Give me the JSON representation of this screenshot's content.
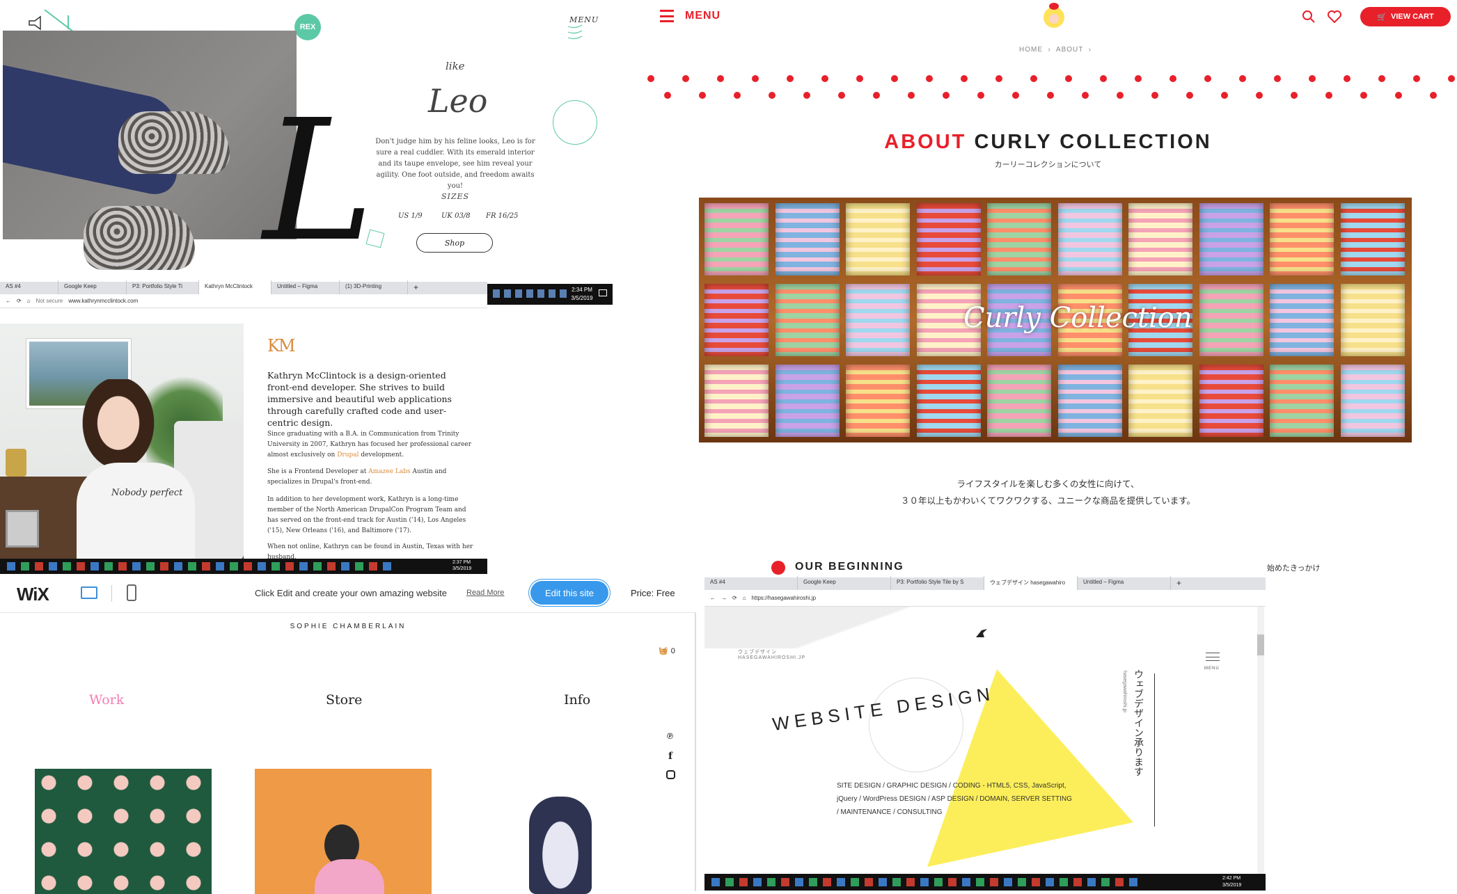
{
  "shoe_site": {
    "menu": "MENU",
    "like": "like",
    "name": "Leo",
    "big_letter": "L",
    "description": "Don't judge him by his feline looks, Leo is for sure a real cuddler. With its emerald interior and its taupe envelope, see him reveal your agility. One foot outside, and freedom awaits you!",
    "sizes_label": "SIZES",
    "sizes": [
      "US 1/9",
      "UK 03/8",
      "FR 16/25"
    ],
    "shop_button": "Shop",
    "logo_text": "REX"
  },
  "browser1": {
    "tabs": [
      "AS #4",
      "Google Keep",
      "P3: Portfolio Style Ti",
      "Kathryn McClintock",
      "Untitled – Figma",
      "(1) 3D-Printing"
    ],
    "url_prefix": "Not secure",
    "url": "www.kathrynmcclintock.com",
    "time": "2:34 PM",
    "date": "3/5/2019"
  },
  "km_site": {
    "logo": "KM",
    "intro": "Kathryn McClintock is a design-oriented front-end developer. She strives to build immersive and beautiful web applications through carefully crafted code and user-centric design.",
    "p1_a": "Since graduating with a B.A. in Communication from Trinity University in 2007, Kathryn has focused her professional career almost exclusively on ",
    "p1_link": "Drupal",
    "p1_b": " development.",
    "p2_a": "She is a Frontend Developer at ",
    "p2_link": "Amazee Labs",
    "p2_b": " Austin and specializes in Drupal's front-end.",
    "p3": "In addition to her development work, Kathryn is a long-time member of the North American DrupalCon Program Team and has served on the front-end track for Austin ('14), Los Angeles ('15), New Orleans ('16), and Baltimore ('17).",
    "p4": "When not online, Kathryn can be found in Austin, Texas with her husband, ",
    "shirt_text": "Nobody perfect",
    "time": "2:37 PM",
    "date": "3/5/2019"
  },
  "curly_site": {
    "menu": "MENU",
    "view_cart": "VIEW CART",
    "breadcrumb": [
      "HOME",
      "ABOUT"
    ],
    "title_a": "ABOUT",
    "title_b": "CURLY COLLECTION",
    "subtitle_jp": "カーリーコレクションについて",
    "hero_text": "Curly Collection",
    "desc_line1": "ライフスタイルを楽しむ多くの女性に向けて、",
    "desc_line2": "３０年以上もかわいくてワクワクする、ユニークな商品を提供しています。",
    "section_title": "OUR BEGINNING",
    "section_jp": "始めたきっかけ"
  },
  "wix_site": {
    "logo": "WiX",
    "cta_text": "Click Edit and create your own amazing website",
    "read_more": "Read More",
    "edit_button": "Edit this site",
    "price": "Price: Free",
    "site_name": "SOPHIE CHAMBERLAIN",
    "cart_count": "0",
    "nav": [
      "Work",
      "Store",
      "Info"
    ],
    "accent": "#f27eb3"
  },
  "browser2": {
    "tabs": [
      "AS #4",
      "Google Keep",
      "P3: Portfolio Style Tile by S",
      "ウェブデザイン hasegawahiro",
      "Untitled – Figma"
    ],
    "url": "https://hasegawahiroshi.jp",
    "time": "2:42 PM",
    "date": "3/5/2019"
  },
  "hasegawa_site": {
    "logo_jp": "ウェブデザイン",
    "logo_en": "HASEGAWAHIROSHI.JP",
    "menu": "MENU",
    "headline": "WEBSITE DESIGN",
    "vertical_jp": "ウェブデザイン承ります",
    "vertical_url": "hasegawahiroshi.jp",
    "services_line1": "SITE DESIGN / GRAPHIC DESIGN / CODING - HTML5, CSS, JavaScript,",
    "services_line2": "jQuery / WordPress DESIGN / ASP DESIGN / DOMAIN, SERVER SETTING",
    "services_line3": "/ MAINTENANCE / CONSULTING"
  }
}
